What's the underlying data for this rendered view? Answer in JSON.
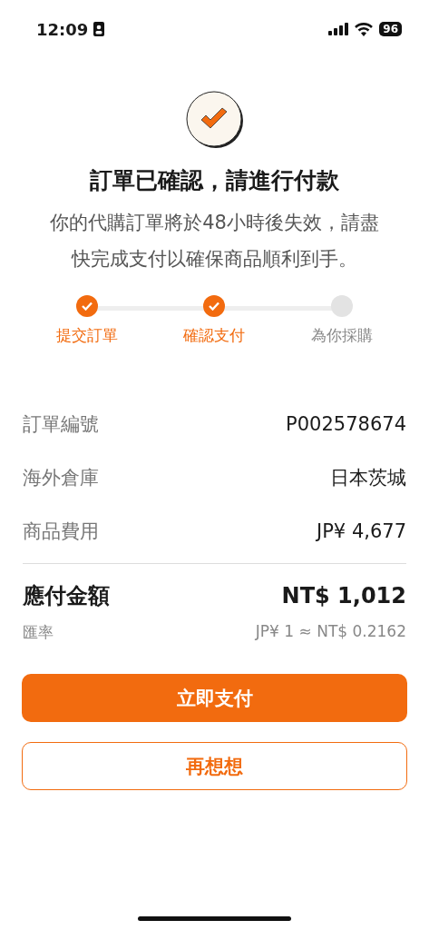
{
  "status_bar": {
    "time": "12:09",
    "battery": "96"
  },
  "title": "訂單已確認，請進行付款",
  "message": "你的代購訂單將於48小時後失效，請盡快完成支付以確保商品順利到手。",
  "steps": [
    {
      "label": "提交訂單",
      "done": true
    },
    {
      "label": "確認支付",
      "done": true
    },
    {
      "label": "為你採購",
      "done": false
    }
  ],
  "details": [
    {
      "label": "訂單編號",
      "value": "P002578674"
    },
    {
      "label": "海外倉庫",
      "value": "日本茨城"
    },
    {
      "label": "商品費用",
      "value": "JP¥ 4,677"
    }
  ],
  "total": {
    "label": "應付金額",
    "value": "NT$ 1,012"
  },
  "rate": {
    "label": "匯率",
    "value": "JP¥ 1 ≈ NT$ 0.2162"
  },
  "buttons": [
    {
      "label": "立即支付",
      "kind": "primary"
    },
    {
      "label": "再想想",
      "kind": "secondary"
    }
  ]
}
